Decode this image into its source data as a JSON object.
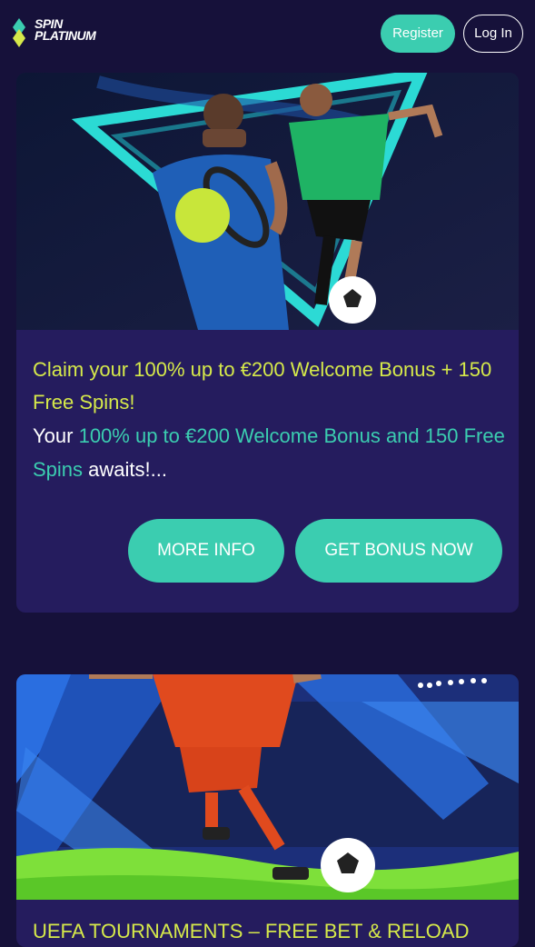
{
  "header": {
    "logo_line1": "SPIN",
    "logo_line2": "PLATINUM",
    "register_label": "Register",
    "login_label": "Log In"
  },
  "promo1": {
    "title": "Claim your 100% up to €200 Welcome Bonus + 150 Free Spins!",
    "desc_prefix": "Your ",
    "desc_highlight1": "100% up to €200 Welcome Bonus and 150 Free Spins",
    "desc_suffix": " awaits!...",
    "more_info_label": "MORE INFO",
    "get_bonus_label": "GET BONUS NOW",
    "image_alt": "tennis-and-football-players"
  },
  "promo2": {
    "title": "UEFA TOURNAMENTS – FREE BET & RELOAD",
    "image_alt": "football-player-kicking-ball"
  },
  "colors": {
    "background": "#16113a",
    "card": "#251c5e",
    "accent": "#3bcdb0",
    "title": "#d6e94a"
  }
}
